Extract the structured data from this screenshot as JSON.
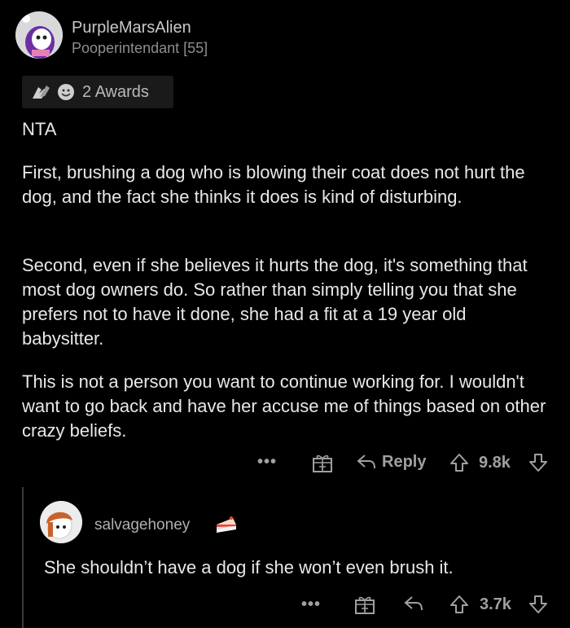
{
  "comment": {
    "username": "PurpleMarsAlien",
    "flair": "Pooperintendant [55]",
    "awards_label": "2 Awards",
    "paragraphs": [
      "NTA",
      "First, brushing a dog who is blowing their coat does not hurt the dog, and the fact she thinks it does is kind of disturbing.",
      "Second, even if she believes it hurts the dog, it's something that most dog owners do. So rather than simply telling you that she prefers not to have it done, she had a fit at a 19 year old babysitter.",
      "This is not a person you want to continue working for. I wouldn't want to go back and have her accuse me of things based on other crazy beliefs."
    ],
    "actions": {
      "more": "•••",
      "reply_label": "Reply",
      "score": "9.8k"
    }
  },
  "reply": {
    "username": "salvagehoney",
    "text": "She shouldn’t have a dog if she won’t even brush it.",
    "actions": {
      "more": "•••",
      "score": "3.7k"
    }
  },
  "icons": {
    "avatar": "reddit-avatar-icon",
    "award1": "clapping-hands-award-icon",
    "award2": "wholesome-award-icon",
    "gift": "gift-icon",
    "reply": "reply-arrow-icon",
    "upvote": "upvote-arrow-icon",
    "downvote": "downvote-arrow-icon",
    "cake": "cake-day-icon"
  },
  "colors": {
    "background": "#000000",
    "text": "#e8e8e8",
    "muted": "#a0a0a0"
  }
}
